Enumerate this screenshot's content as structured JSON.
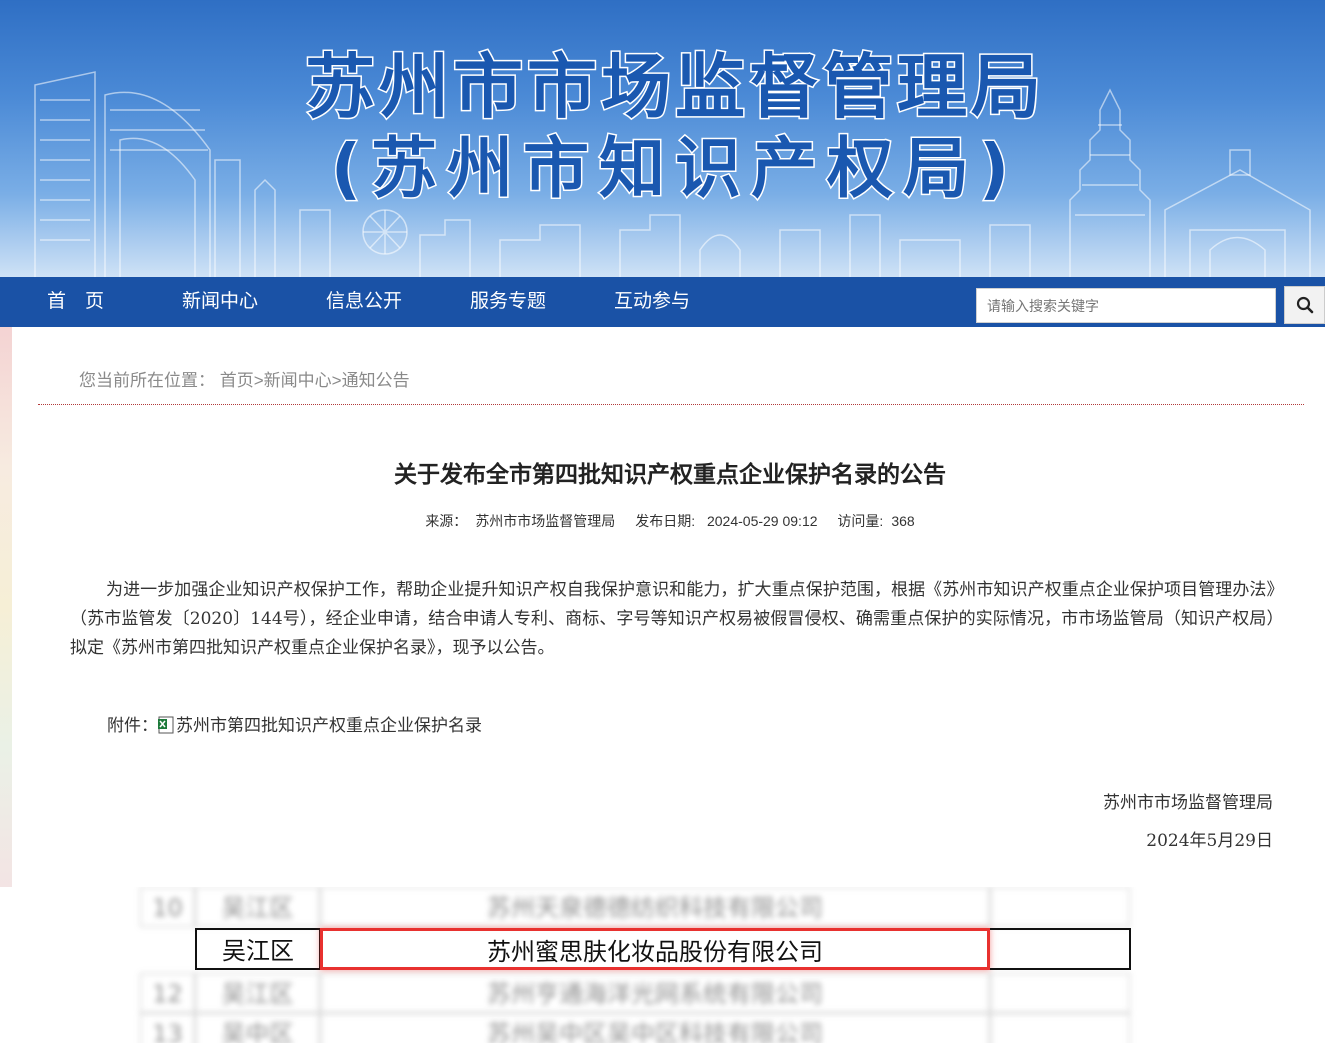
{
  "banner": {
    "title": "苏州市市场监督管理局",
    "subtitle": "(苏州市知识产权局)"
  },
  "nav": {
    "items": [
      "首　页",
      "新闻中心",
      "信息公开",
      "服务专题",
      "互动参与"
    ],
    "search_placeholder": "请输入搜索关键字",
    "search_icon": "search-icon"
  },
  "breadcrumb": {
    "prefix": "您当前所在位置：",
    "items": [
      "首页",
      "新闻中心",
      "通知公告"
    ],
    "separator": ">"
  },
  "article": {
    "title": "关于发布全市第四批知识产权重点企业保护名录的公告",
    "source_label": "来源：",
    "source": "苏州市市场监督管理局",
    "date_label": "发布日期:",
    "date": "2024-05-29 09:12",
    "views_label": "访问量:",
    "views": "368",
    "body": "为进一步加强企业知识产权保护工作，帮助企业提升知识产权自我保护意识和能力，扩大重点保护范围，根据《苏州市知识产权重点企业保护项目管理办法》（苏市监管发〔2020〕144号），经企业申请，结合申请人专利、商标、字号等知识产权易被假冒侵权、确需重点保护的实际情况，市市场监管局（知识产权局）拟定《苏州市第四批知识产权重点企业保护名录》，现予以公告。",
    "attachment_label": "附件：",
    "attachment_icon": "excel-file-icon",
    "attachment_name": "苏州市第四批知识产权重点企业保护名录",
    "signature": "苏州市市场监督管理局",
    "signature_date": "2024年5月29日"
  },
  "table_crop": {
    "highlight_row": {
      "district": "吴江区",
      "company": "苏州蜜思肤化妆品股份有限公司"
    },
    "blurred_rows": [
      {
        "no": "10",
        "district": "吴江区",
        "company": "苏州天泉德德纺织科技有限公司"
      },
      {
        "no": "12",
        "district": "吴江区",
        "company": "苏州亨通海洋光网系统有限公司"
      },
      {
        "no": "13",
        "district": "吴中区",
        "company": "苏州吴中区吴中区科技有限公司"
      }
    ]
  }
}
